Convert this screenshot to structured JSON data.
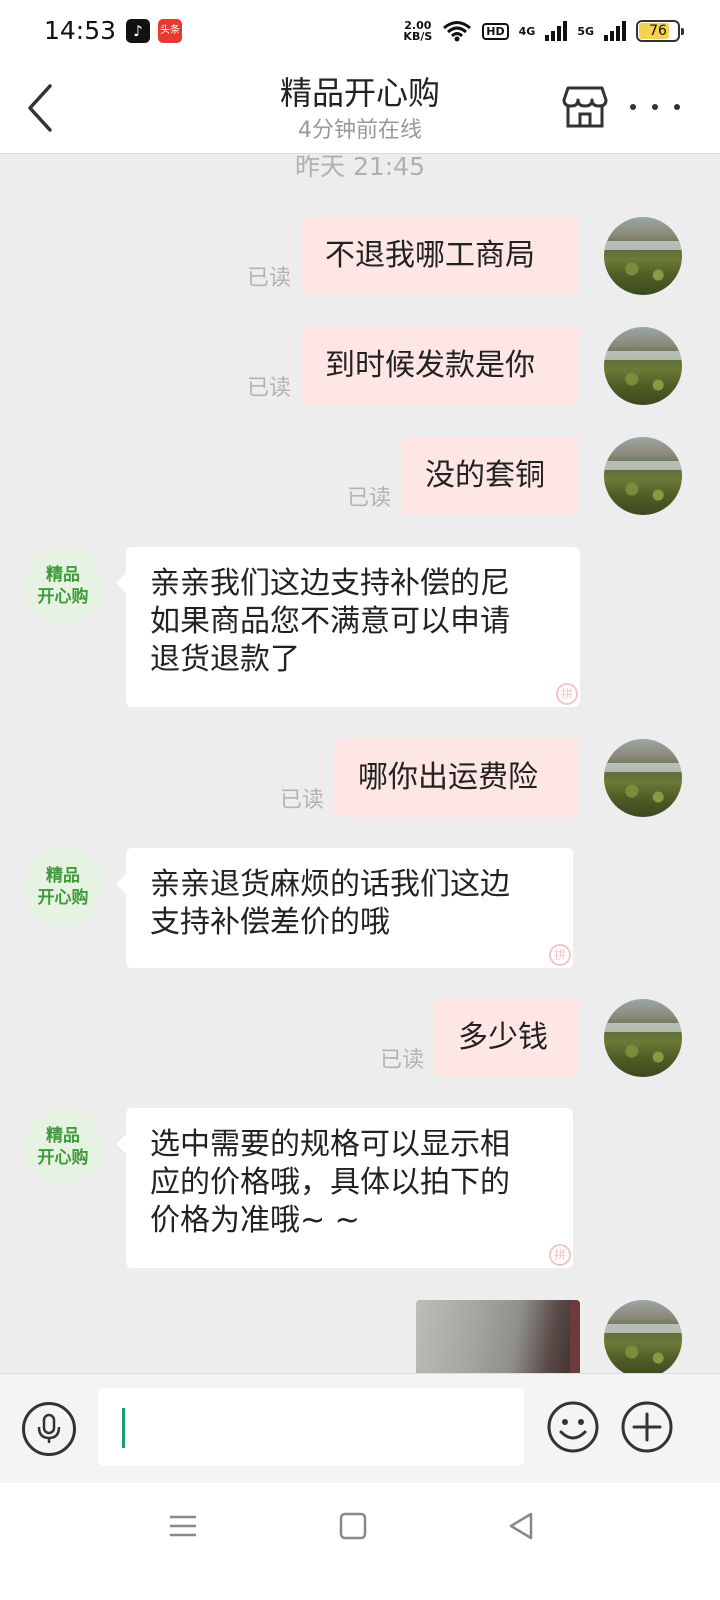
{
  "status_bar": {
    "time": "14:53",
    "app_tiktok": "♪",
    "app_toutiao": "头条",
    "net_speed_value": "2.00",
    "net_speed_unit": "KB/S",
    "hd_label": "HD",
    "net_4g": "4G",
    "net_5g": "5G",
    "battery": "76"
  },
  "header": {
    "title": "精品开心购",
    "subtitle": "4分钟前在线"
  },
  "chat": {
    "timestamp": "昨天 21:45",
    "read_label": "已读",
    "shop_avatar_line1": "精品",
    "shop_avatar_line2": "开心购",
    "shop_mark": "拼",
    "messages": [
      {
        "from": "me",
        "text": "不退我哪工商局"
      },
      {
        "from": "me",
        "text": "到时候发款是你"
      },
      {
        "from": "me",
        "text": "没的套铜"
      },
      {
        "from": "shop",
        "lines": [
          "亲亲我们这边支持补偿的尼",
          "如果商品您不满意可以申请",
          "退货退款了"
        ]
      },
      {
        "from": "me",
        "text": "哪你出运费险"
      },
      {
        "from": "shop",
        "lines": [
          "亲亲退货麻烦的话我们这边",
          "支持补偿差价的哦"
        ]
      },
      {
        "from": "me",
        "text": "多少钱"
      },
      {
        "from": "shop",
        "lines": [
          "选中需要的规格可以显示相",
          "应的价格哦，具体以拍下的",
          "价格为准哦~ ~"
        ]
      },
      {
        "from": "me",
        "type": "image"
      }
    ]
  },
  "colors": {
    "my_bubble": "#fde6e4",
    "shop_bubble": "#ffffff",
    "shop_avatar_bg": "#e6f3e3",
    "shop_avatar_text": "#3f9b3a",
    "caret": "#1a9f6a"
  },
  "icons": [
    "back-icon",
    "store-icon",
    "more-icon",
    "mic-icon",
    "emoji-icon",
    "plus-icon",
    "nav-menu-icon",
    "nav-home-icon",
    "nav-back-icon"
  ]
}
